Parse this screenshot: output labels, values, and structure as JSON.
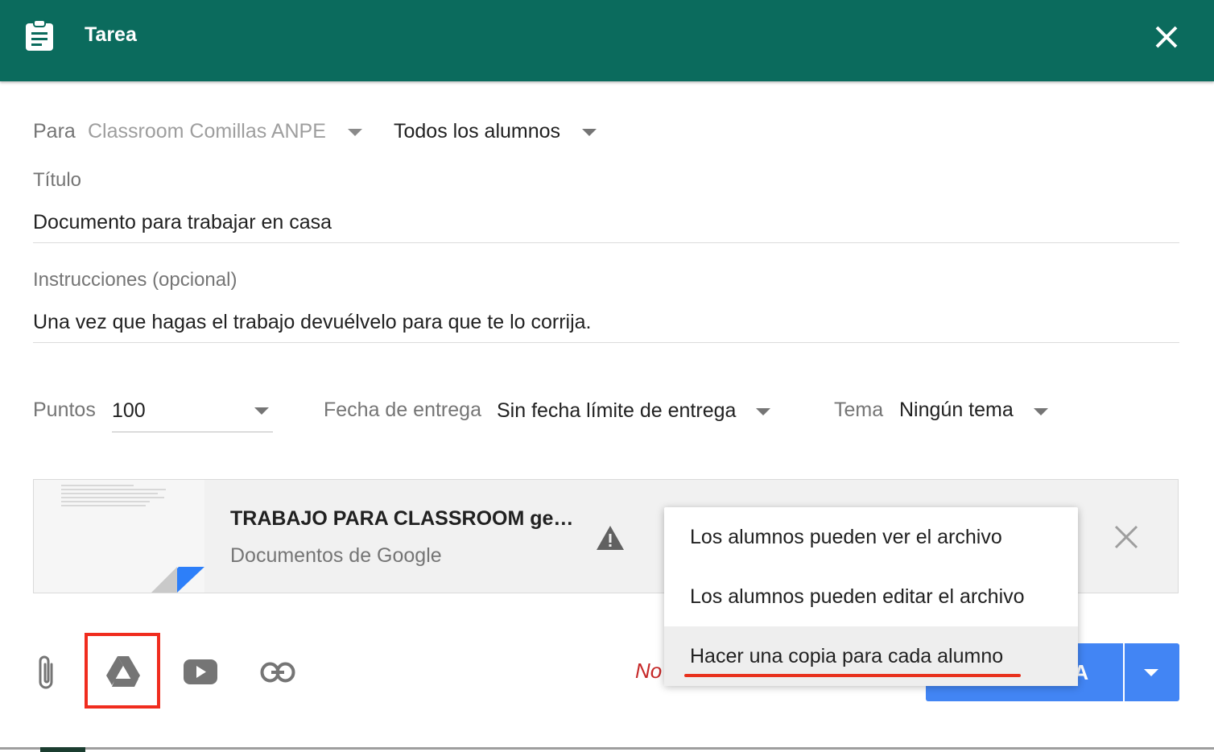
{
  "header": {
    "title": "Tarea",
    "icon": "clipboard-icon",
    "close_icon": "close-icon",
    "bg_color": "#0b6b5d"
  },
  "para": {
    "label": "Para",
    "class_name": "Classroom Comillas ANPE",
    "students": "Todos los alumnos"
  },
  "title_field": {
    "label": "Título",
    "value": "Documento para trabajar en casa"
  },
  "instructions_field": {
    "label": "Instrucciones (opcional)",
    "value": "Una vez que hagas el trabajo devuélvelo para que te lo corrija."
  },
  "points": {
    "label": "Puntos",
    "value": "100"
  },
  "due_date": {
    "label": "Fecha de entrega",
    "value": "Sin fecha límite de entrega"
  },
  "topic": {
    "label": "Tema",
    "value": "Ningún tema"
  },
  "attachment": {
    "title": "TRABAJO PARA CLASSROOM ge…",
    "subtitle": "Documentos de Google",
    "warning_icon": "warning-icon",
    "remove_icon": "close-icon"
  },
  "share_menu": {
    "items": [
      {
        "label": "Los alumnos pueden ver el archivo"
      },
      {
        "label": "Los alumnos pueden editar el archivo"
      },
      {
        "label": "Hacer una copia para cada alumno"
      }
    ],
    "selected_index": 2
  },
  "toolbar": {
    "icons": [
      "paperclip-icon",
      "drive-icon",
      "youtube-icon",
      "link-icon"
    ]
  },
  "footer": {
    "error_text": "No",
    "assign_label": "EA",
    "accent_color": "#4285f4",
    "highlight_color": "#f02c1e"
  }
}
